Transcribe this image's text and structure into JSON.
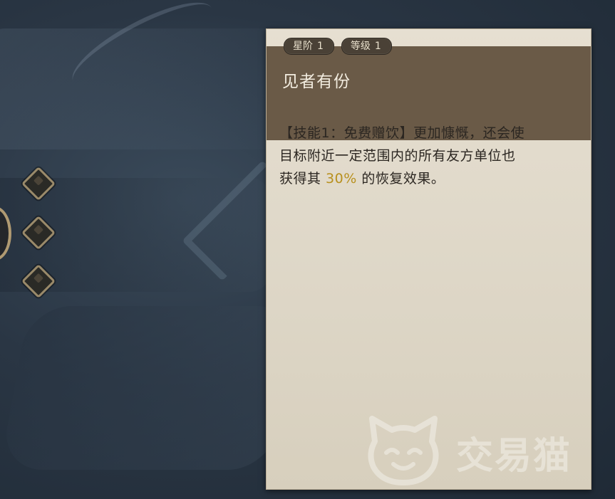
{
  "card": {
    "badges": [
      {
        "label": "星阶",
        "value": "1"
      },
      {
        "label": "等级",
        "value": "1"
      }
    ],
    "title": "见者有份",
    "description": {
      "line1": "【技能1：免费赠饮】更加慷慨，还会使",
      "line2": "目标附近一定范围内的所有友方单位也",
      "line3_prefix": "获得其 ",
      "line3_highlight": "30%",
      "line3_suffix": " 的恢复效果。"
    }
  },
  "watermark": {
    "text": "交易猫",
    "icon": "cat-face-icon"
  },
  "colors": {
    "header": "#6a5a47",
    "card_bg": "#e6dfd1",
    "highlight": "#b8901e",
    "background": "#2a3644"
  }
}
